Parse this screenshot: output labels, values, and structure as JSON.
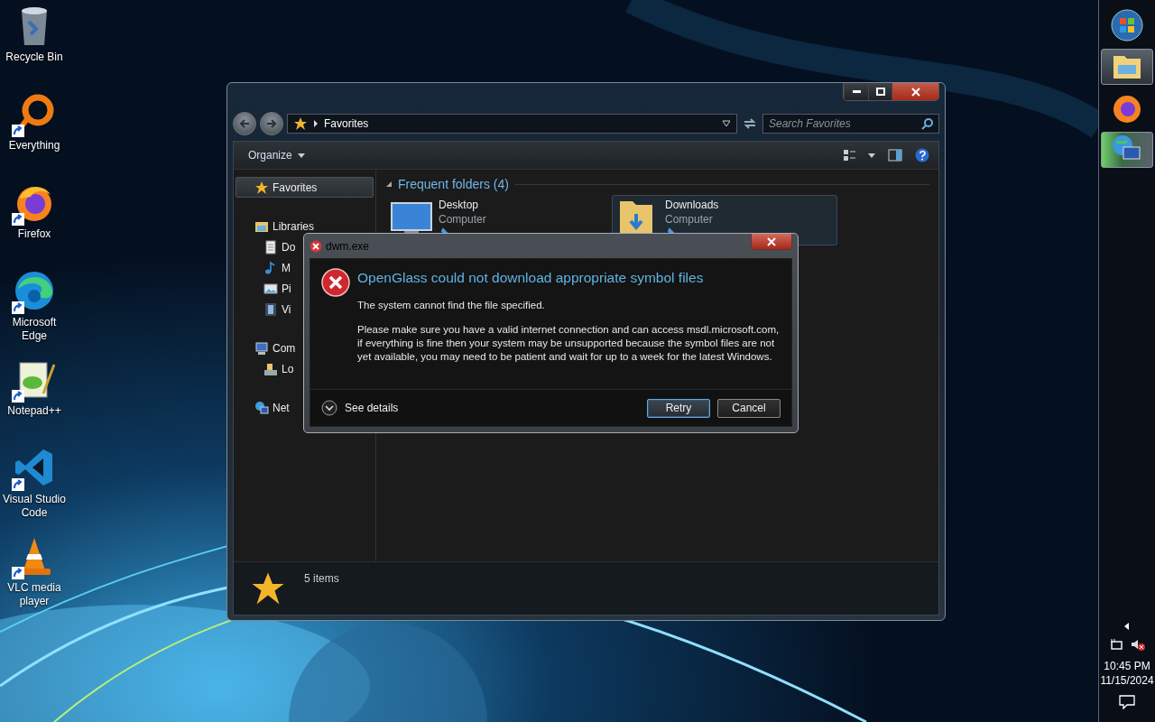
{
  "desktop_icons": [
    {
      "label": "Recycle Bin",
      "kind": "recycle",
      "shortcut": false
    },
    {
      "label": "Everything",
      "kind": "everything",
      "shortcut": true
    },
    {
      "label": "Firefox",
      "kind": "firefox",
      "shortcut": true
    },
    {
      "label": "Microsoft Edge",
      "kind": "edge",
      "shortcut": true
    },
    {
      "label": "Notepad++",
      "kind": "notepad",
      "shortcut": true
    },
    {
      "label": "Visual Studio Code",
      "kind": "vscode",
      "shortcut": true
    },
    {
      "label": "VLC media player",
      "kind": "vlc",
      "shortcut": true
    }
  ],
  "explorer": {
    "address": "Favorites",
    "search": {
      "placeholder": "Search Favorites"
    },
    "organize": "Organize",
    "nav": [
      {
        "label": "Favorites",
        "kind": "favorites",
        "selected": true
      },
      {
        "label": "Libraries",
        "kind": "libraries",
        "selected": false,
        "children": [
          {
            "label": "Do",
            "kind": "document",
            "selected": false
          },
          {
            "label": "M",
            "kind": "music",
            "selected": false
          },
          {
            "label": "Pi",
            "kind": "pictures",
            "selected": false
          },
          {
            "label": "Vi",
            "kind": "videos",
            "selected": false
          }
        ]
      },
      {
        "label": "Com",
        "kind": "computer",
        "selected": false,
        "children": [
          {
            "label": "Lo",
            "kind": "disk",
            "selected": false
          }
        ]
      },
      {
        "label": "Net",
        "kind": "network",
        "selected": false
      }
    ],
    "group": {
      "title": "Frequent folders (4)",
      "expanded": true,
      "items": [
        {
          "name": "Desktop",
          "location": "Computer",
          "kind": "desktop",
          "pinned": true,
          "hovered": false
        },
        {
          "name": "Downloads",
          "location": "Computer",
          "kind": "downloads",
          "pinned": true,
          "hovered": true
        }
      ]
    },
    "status": "5 items"
  },
  "dialog": {
    "title": "dwm.exe",
    "heading": "OpenGlass could not download appropriate symbol files",
    "message": "The system cannot find the file specified.",
    "details": "Please make sure you have a valid internet connection and can access msdl.microsoft.com, if everything is fine then your system may be unsupported because the symbol files are not yet available, you may need to be patient and wait for up to a week for the latest Windows.",
    "toggle": "See details",
    "buttons": [
      {
        "label": "Retry",
        "default": true
      },
      {
        "label": "Cancel",
        "default": false
      }
    ]
  },
  "taskbar": {
    "apps": [
      {
        "kind": "start",
        "open": false,
        "attention": false
      },
      {
        "kind": "explorer",
        "open": true,
        "attention": false
      },
      {
        "kind": "firefox",
        "open": false,
        "attention": false
      },
      {
        "kind": "network",
        "open": true,
        "attention": true
      }
    ],
    "tray": {
      "muted": true,
      "time": "10:45 PM",
      "date": "11/15/2024"
    }
  }
}
